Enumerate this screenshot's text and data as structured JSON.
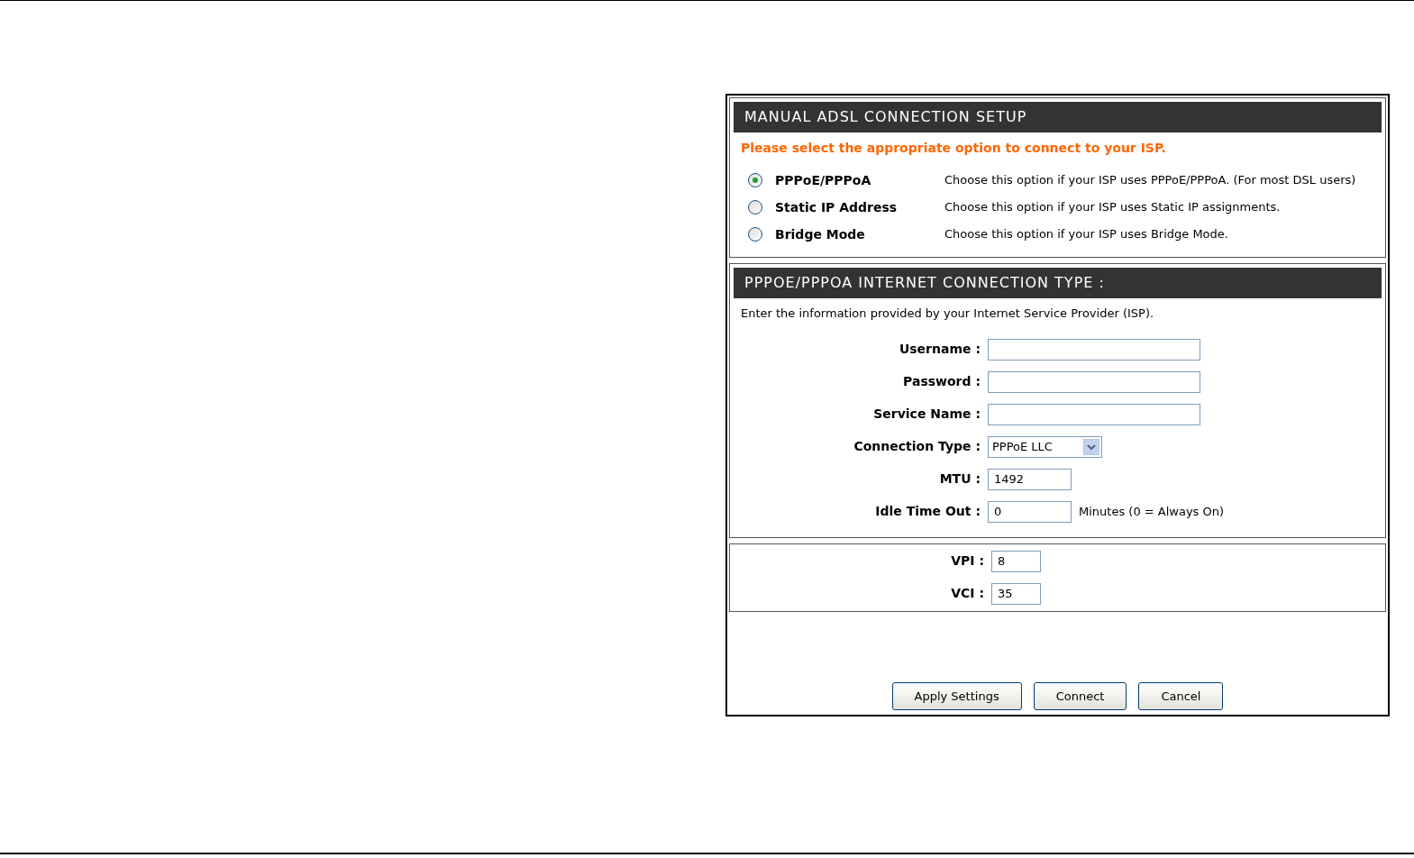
{
  "setup": {
    "title": "MANUAL ADSL CONNECTION SETUP",
    "prompt": "Please select the appropriate option to connect to your ISP.",
    "options": [
      {
        "label": "PPPoE/PPPoA",
        "description": "Choose this option if your ISP uses PPPoE/PPPoA. (For most DSL users)",
        "selected": true
      },
      {
        "label": "Static IP Address",
        "description": "Choose this option if your ISP uses Static IP assignments.",
        "selected": false
      },
      {
        "label": "Bridge Mode",
        "description": "Choose this option if your ISP uses Bridge Mode.",
        "selected": false
      }
    ]
  },
  "connection": {
    "title": "PPPOE/PPPOA INTERNET CONNECTION TYPE :",
    "intro": "Enter the information provided by your Internet Service Provider (ISP).",
    "fields": [
      {
        "kind": "long_text",
        "label": "Username :"
      },
      {
        "kind": "long_text",
        "label": "Password :"
      },
      {
        "kind": "long_text",
        "label": "Service Name :"
      },
      {
        "kind": "select",
        "label": "Connection Type :",
        "value": "PPPoE LLC"
      },
      {
        "kind": "short_text",
        "label": "MTU :",
        "value": "1492"
      },
      {
        "kind": "short_text",
        "label": "Idle Time Out :",
        "value": "0",
        "suffix": "Minutes (0 = Always On)"
      }
    ]
  },
  "vc": {
    "fields": [
      {
        "label": "VPI :",
        "value": "8"
      },
      {
        "label": "VCI :",
        "value": "35"
      }
    ]
  },
  "buttons": [
    "Apply Settings",
    "Connect",
    "Cancel"
  ]
}
